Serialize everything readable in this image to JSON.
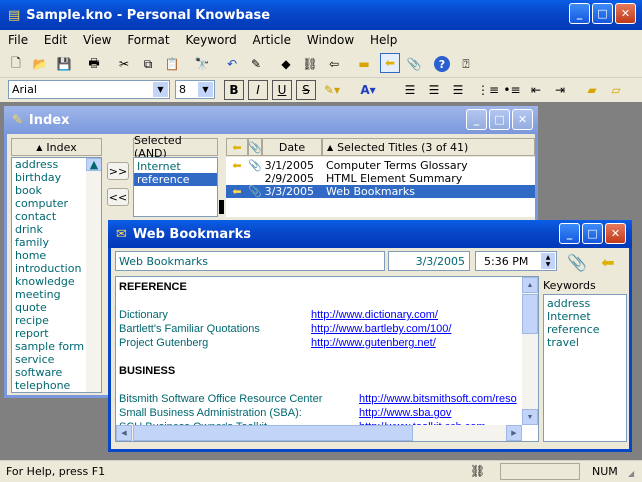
{
  "app": {
    "title": "Sample.kno - Personal Knowbase"
  },
  "menu": [
    "File",
    "Edit",
    "View",
    "Format",
    "Keyword",
    "Article",
    "Window",
    "Help"
  ],
  "format_bar": {
    "font": "Arial",
    "size": "8"
  },
  "index_window": {
    "title": "Index",
    "index_header": "Index",
    "keywords": [
      "address",
      "birthday",
      "book",
      "computer",
      "contact",
      "drink",
      "family",
      "home",
      "introduction",
      "knowledge",
      "meeting",
      "quote",
      "recipe",
      "report",
      "sample form",
      "service",
      "software",
      "telephone"
    ],
    "add_btn": ">>",
    "remove_btn": "<<",
    "selected_header": "Selected (AND)",
    "selected": [
      "Internet",
      "reference"
    ],
    "col_date": "Date",
    "col_titles": "Selected Titles (3 of 41)",
    "rows": [
      {
        "date": "3/1/2005",
        "title": "Computer Terms Glossary"
      },
      {
        "date": "2/9/2005",
        "title": "HTML Element Summary"
      },
      {
        "date": "3/3/2005",
        "title": "Web Bookmarks"
      }
    ]
  },
  "article_window": {
    "title": "Web Bookmarks",
    "name": "Web Bookmarks",
    "date": "3/3/2005",
    "time": "5:36 PM",
    "section1": "REFERENCE",
    "ref_rows": [
      {
        "label": "Dictionary",
        "url": "http://www.dictionary.com/"
      },
      {
        "label": "Bartlett's Familiar Quotations",
        "url": "http://www.bartleby.com/100/"
      },
      {
        "label": "Project Gutenberg",
        "url": "http://www.gutenberg.net/"
      }
    ],
    "section2": "BUSINESS",
    "biz_rows": [
      {
        "label": "Bitsmith Software Office Resource Center",
        "url": "http://www.bitsmithsoft.com/reso"
      },
      {
        "label": "Small Business Administration (SBA):",
        "url": "http://www.sba.gov"
      },
      {
        "label": "SCU Business Owner's Toolkit",
        "url": "http://www.toolkit.cch.com"
      }
    ],
    "keywords_label": "Keywords",
    "keywords": [
      "address",
      "Internet",
      "reference",
      "travel"
    ]
  },
  "status": {
    "help": "For Help, press F1",
    "num": "NUM"
  }
}
